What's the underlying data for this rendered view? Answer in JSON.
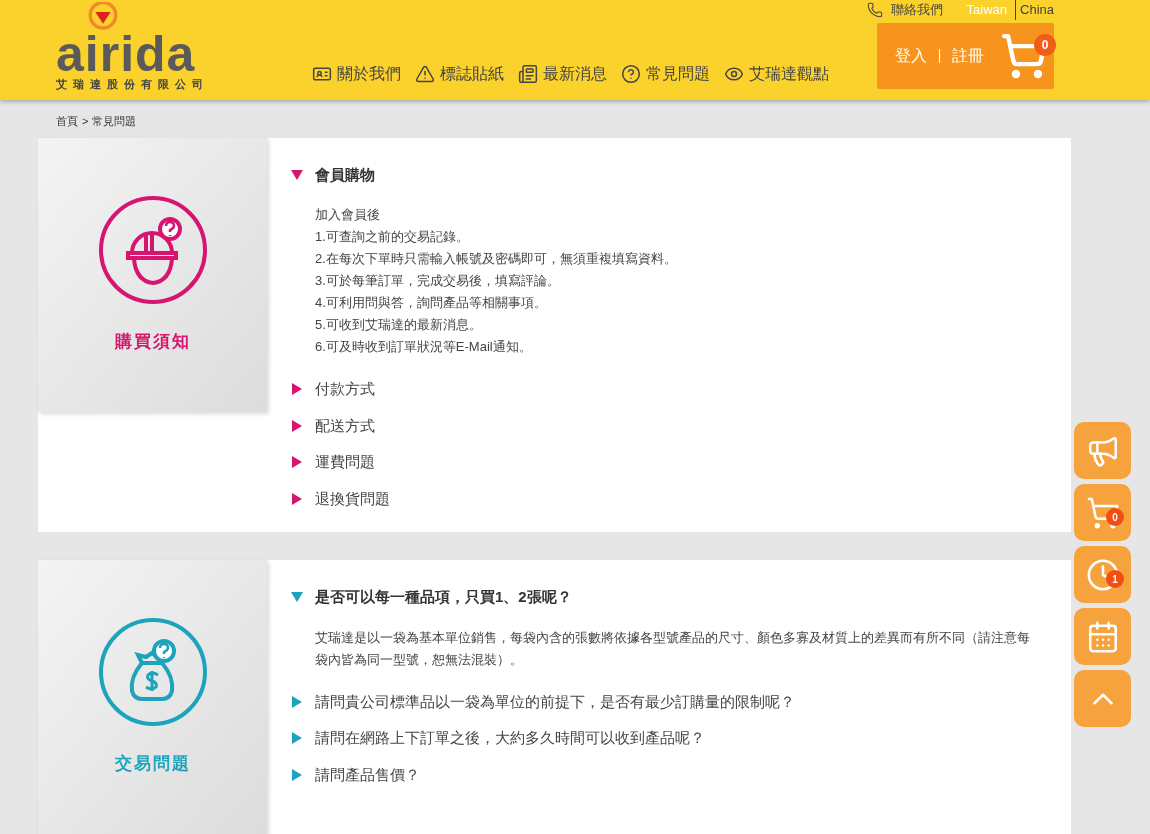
{
  "header": {
    "logo": {
      "wordmark": "airida",
      "company": "艾瑞達股份有限公司"
    },
    "contact": "聯絡我們",
    "languages": [
      {
        "label": "Taiwan",
        "selected": true
      },
      {
        "label": "China",
        "selected": false
      }
    ],
    "nav": [
      {
        "kind": "card",
        "label": "關於我們"
      },
      {
        "kind": "warning",
        "label": "標誌貼紙"
      },
      {
        "kind": "news",
        "label": "最新消息"
      },
      {
        "kind": "help",
        "label": "常見問題"
      },
      {
        "kind": "eye",
        "label": "艾瑞達觀點"
      }
    ],
    "account": {
      "login": "登入",
      "register": "註冊",
      "cart_count": "0"
    }
  },
  "breadcrumb": {
    "items": [
      "首頁",
      "常見問題"
    ],
    "separator": ">"
  },
  "sections": [
    {
      "title": "購買須知",
      "color": "#d6156f",
      "kind": "helmet",
      "items": [
        {
          "question": "會員購物",
          "expanded": true,
          "answer": [
            "加入會員後",
            "1.可查詢之前的交易記錄。",
            "2.在每次下單時只需輸入帳號及密碼即可，無須重複填寫資料。",
            "3.可於每筆訂單，完成交易後，填寫評論。",
            "4.可利用問與答，詢問產品等相關事項。",
            "5.可收到艾瑞達的最新消息。",
            "6.可及時收到訂單狀況等E-Mail通知。"
          ]
        },
        {
          "question": "付款方式",
          "expanded": false
        },
        {
          "question": "配送方式",
          "expanded": false
        },
        {
          "question": "運費問題",
          "expanded": false
        },
        {
          "question": "退換貨問題",
          "expanded": false
        }
      ]
    },
    {
      "title": "交易問題",
      "color": "#1ea3bd",
      "kind": "moneybag",
      "items": [
        {
          "question": "是否可以每一種品項，只買1、2張呢？",
          "expanded": true,
          "answer": [
            "艾瑞達是以一袋為基本單位銷售，每袋內含的張數將依據各型號產品的尺寸、顏色多寡及材質上的差異而有所不同（請注意每袋內皆為同一型號，恕無法混裝）。"
          ]
        },
        {
          "question": "請問貴公司標準品以一袋為單位的前提下，是否有最少訂購量的限制呢？",
          "expanded": false
        },
        {
          "question": "請問在網路上下訂單之後，大約多久時間可以收到產品呢？",
          "expanded": false
        },
        {
          "question": "請問產品售價？",
          "expanded": false
        }
      ]
    }
  ],
  "floating_buttons": [
    {
      "kind": "megaphone"
    },
    {
      "kind": "cart",
      "badge": "0"
    },
    {
      "kind": "clock",
      "badge": "1"
    },
    {
      "kind": "calendar"
    },
    {
      "kind": "up"
    }
  ]
}
